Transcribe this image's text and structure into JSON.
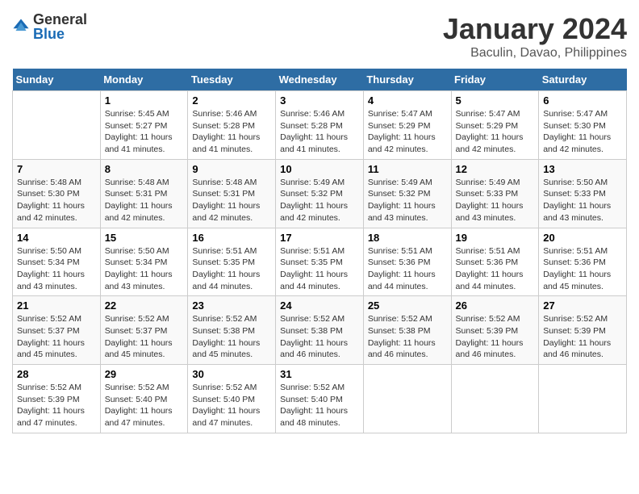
{
  "header": {
    "logo_general": "General",
    "logo_blue": "Blue",
    "month_title": "January 2024",
    "location": "Baculin, Davao, Philippines"
  },
  "days_of_week": [
    "Sunday",
    "Monday",
    "Tuesday",
    "Wednesday",
    "Thursday",
    "Friday",
    "Saturday"
  ],
  "weeks": [
    [
      {
        "day": "",
        "info": ""
      },
      {
        "day": "1",
        "info": "Sunrise: 5:45 AM\nSunset: 5:27 PM\nDaylight: 11 hours\nand 41 minutes."
      },
      {
        "day": "2",
        "info": "Sunrise: 5:46 AM\nSunset: 5:28 PM\nDaylight: 11 hours\nand 41 minutes."
      },
      {
        "day": "3",
        "info": "Sunrise: 5:46 AM\nSunset: 5:28 PM\nDaylight: 11 hours\nand 41 minutes."
      },
      {
        "day": "4",
        "info": "Sunrise: 5:47 AM\nSunset: 5:29 PM\nDaylight: 11 hours\nand 42 minutes."
      },
      {
        "day": "5",
        "info": "Sunrise: 5:47 AM\nSunset: 5:29 PM\nDaylight: 11 hours\nand 42 minutes."
      },
      {
        "day": "6",
        "info": "Sunrise: 5:47 AM\nSunset: 5:30 PM\nDaylight: 11 hours\nand 42 minutes."
      }
    ],
    [
      {
        "day": "7",
        "info": "Sunrise: 5:48 AM\nSunset: 5:30 PM\nDaylight: 11 hours\nand 42 minutes."
      },
      {
        "day": "8",
        "info": "Sunrise: 5:48 AM\nSunset: 5:31 PM\nDaylight: 11 hours\nand 42 minutes."
      },
      {
        "day": "9",
        "info": "Sunrise: 5:48 AM\nSunset: 5:31 PM\nDaylight: 11 hours\nand 42 minutes."
      },
      {
        "day": "10",
        "info": "Sunrise: 5:49 AM\nSunset: 5:32 PM\nDaylight: 11 hours\nand 42 minutes."
      },
      {
        "day": "11",
        "info": "Sunrise: 5:49 AM\nSunset: 5:32 PM\nDaylight: 11 hours\nand 43 minutes."
      },
      {
        "day": "12",
        "info": "Sunrise: 5:49 AM\nSunset: 5:33 PM\nDaylight: 11 hours\nand 43 minutes."
      },
      {
        "day": "13",
        "info": "Sunrise: 5:50 AM\nSunset: 5:33 PM\nDaylight: 11 hours\nand 43 minutes."
      }
    ],
    [
      {
        "day": "14",
        "info": "Sunrise: 5:50 AM\nSunset: 5:34 PM\nDaylight: 11 hours\nand 43 minutes."
      },
      {
        "day": "15",
        "info": "Sunrise: 5:50 AM\nSunset: 5:34 PM\nDaylight: 11 hours\nand 43 minutes."
      },
      {
        "day": "16",
        "info": "Sunrise: 5:51 AM\nSunset: 5:35 PM\nDaylight: 11 hours\nand 44 minutes."
      },
      {
        "day": "17",
        "info": "Sunrise: 5:51 AM\nSunset: 5:35 PM\nDaylight: 11 hours\nand 44 minutes."
      },
      {
        "day": "18",
        "info": "Sunrise: 5:51 AM\nSunset: 5:36 PM\nDaylight: 11 hours\nand 44 minutes."
      },
      {
        "day": "19",
        "info": "Sunrise: 5:51 AM\nSunset: 5:36 PM\nDaylight: 11 hours\nand 44 minutes."
      },
      {
        "day": "20",
        "info": "Sunrise: 5:51 AM\nSunset: 5:36 PM\nDaylight: 11 hours\nand 45 minutes."
      }
    ],
    [
      {
        "day": "21",
        "info": "Sunrise: 5:52 AM\nSunset: 5:37 PM\nDaylight: 11 hours\nand 45 minutes."
      },
      {
        "day": "22",
        "info": "Sunrise: 5:52 AM\nSunset: 5:37 PM\nDaylight: 11 hours\nand 45 minutes."
      },
      {
        "day": "23",
        "info": "Sunrise: 5:52 AM\nSunset: 5:38 PM\nDaylight: 11 hours\nand 45 minutes."
      },
      {
        "day": "24",
        "info": "Sunrise: 5:52 AM\nSunset: 5:38 PM\nDaylight: 11 hours\nand 46 minutes."
      },
      {
        "day": "25",
        "info": "Sunrise: 5:52 AM\nSunset: 5:38 PM\nDaylight: 11 hours\nand 46 minutes."
      },
      {
        "day": "26",
        "info": "Sunrise: 5:52 AM\nSunset: 5:39 PM\nDaylight: 11 hours\nand 46 minutes."
      },
      {
        "day": "27",
        "info": "Sunrise: 5:52 AM\nSunset: 5:39 PM\nDaylight: 11 hours\nand 46 minutes."
      }
    ],
    [
      {
        "day": "28",
        "info": "Sunrise: 5:52 AM\nSunset: 5:39 PM\nDaylight: 11 hours\nand 47 minutes."
      },
      {
        "day": "29",
        "info": "Sunrise: 5:52 AM\nSunset: 5:40 PM\nDaylight: 11 hours\nand 47 minutes."
      },
      {
        "day": "30",
        "info": "Sunrise: 5:52 AM\nSunset: 5:40 PM\nDaylight: 11 hours\nand 47 minutes."
      },
      {
        "day": "31",
        "info": "Sunrise: 5:52 AM\nSunset: 5:40 PM\nDaylight: 11 hours\nand 48 minutes."
      },
      {
        "day": "",
        "info": ""
      },
      {
        "day": "",
        "info": ""
      },
      {
        "day": "",
        "info": ""
      }
    ]
  ]
}
